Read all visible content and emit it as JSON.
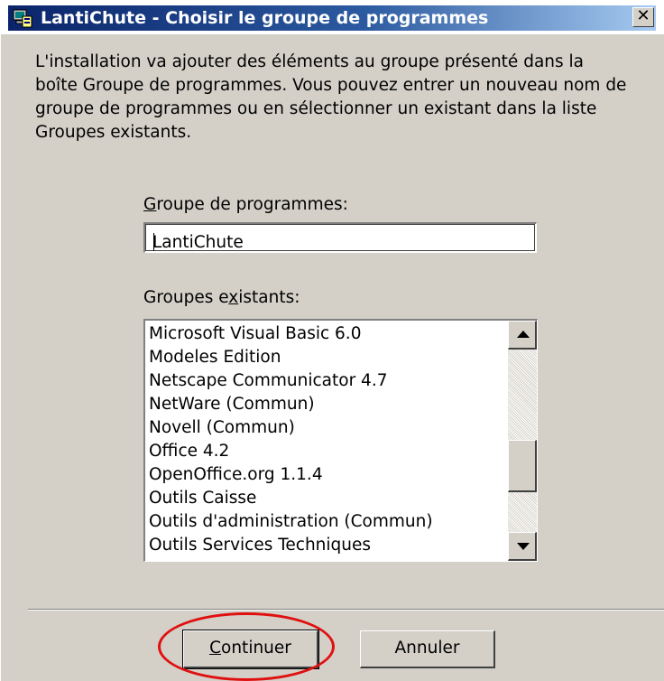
{
  "window": {
    "title": "LantiChute - Choisir le groupe de programmes",
    "close_glyph": "✕"
  },
  "intro_text": "L'installation va ajouter des éléments au groupe présenté dans la boîte Groupe de programmes. Vous pouvez entrer un nouveau nom de groupe de programmes ou en sélectionner un existant dans la liste Groupes existants.",
  "program_group": {
    "label_prefix": "",
    "label_mnemonic": "G",
    "label_rest": "roupe de programmes:",
    "value": "LantiChute"
  },
  "existing_groups": {
    "label_prefix": "Groupes e",
    "label_mnemonic": "x",
    "label_rest": "istants:",
    "items": [
      "Microsoft Visual Basic 6.0",
      "Modeles Edition",
      "Netscape Communicator 4.7",
      "NetWare (Commun)",
      "Novell (Commun)",
      "Office 4.2",
      "OpenOffice.org 1.1.4",
      "Outils Caisse",
      "Outils d'administration (Commun)",
      "Outils Services Techniques"
    ]
  },
  "buttons": {
    "continue_mnemonic": "C",
    "continue_rest": "ontinuer",
    "cancel": "Annuler"
  },
  "icons": {
    "app": "setup-computer-icon",
    "scroll_up": "triangle-up-icon",
    "scroll_down": "triangle-down-icon"
  },
  "colors": {
    "titlebar_start": "#0a246a",
    "titlebar_end": "#a6caf0",
    "face": "#d4d0c8",
    "annotation": "#e01010"
  }
}
